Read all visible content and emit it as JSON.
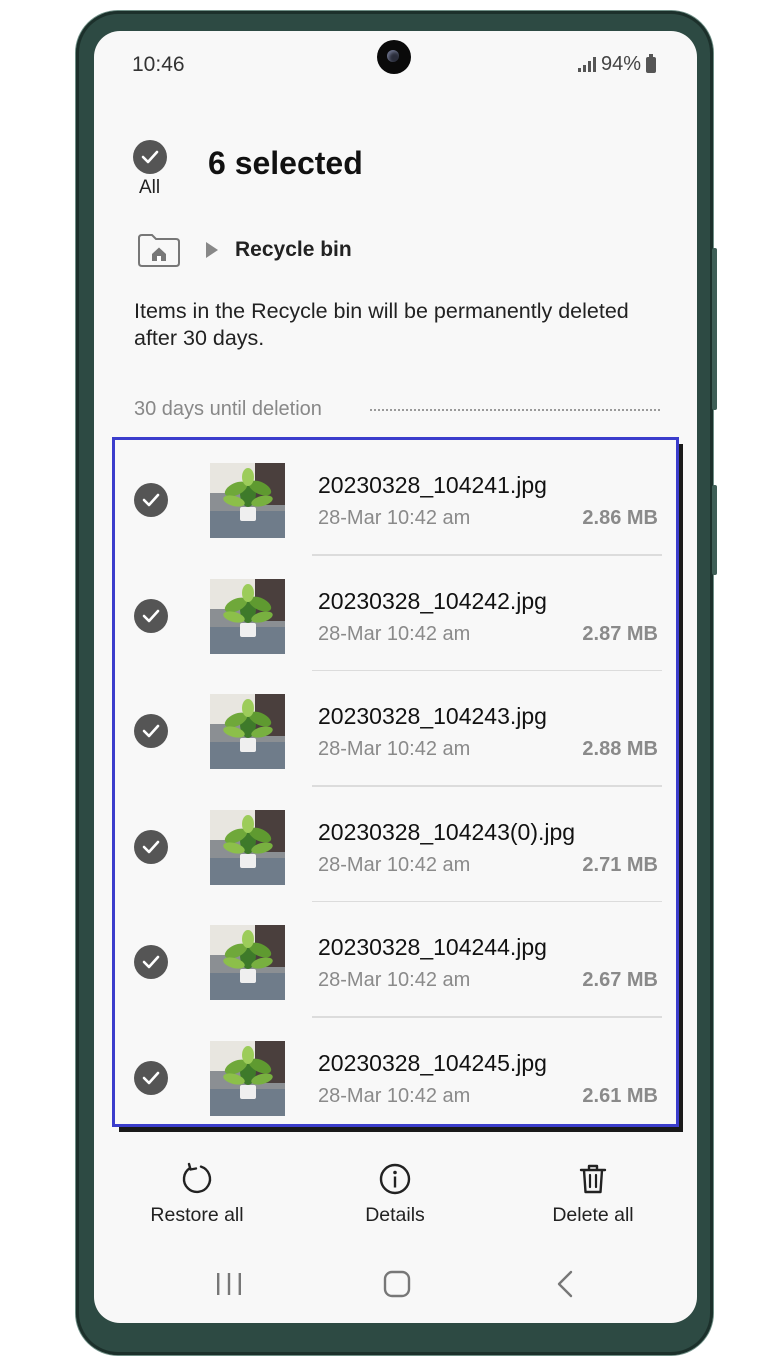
{
  "status_bar": {
    "time": "10:46",
    "battery": "94%"
  },
  "header": {
    "selected_label": "6 selected",
    "all_label": "All"
  },
  "breadcrumb": {
    "location": "Recycle bin"
  },
  "info_text": "Items in the Recycle bin will be permanently deleted after 30 days.",
  "section": {
    "label": "30 days until deletion"
  },
  "files": [
    {
      "name": "20230328_104241.jpg",
      "date": "28-Mar 10:42 am",
      "size": "2.86 MB",
      "checked": true
    },
    {
      "name": "20230328_104242.jpg",
      "date": "28-Mar 10:42 am",
      "size": "2.87 MB",
      "checked": true
    },
    {
      "name": "20230328_104243.jpg",
      "date": "28-Mar 10:42 am",
      "size": "2.88 MB",
      "checked": true
    },
    {
      "name": "20230328_104243(0).jpg",
      "date": "28-Mar 10:42 am",
      "size": "2.71 MB",
      "checked": true
    },
    {
      "name": "20230328_104244.jpg",
      "date": "28-Mar 10:42 am",
      "size": "2.67 MB",
      "checked": true
    },
    {
      "name": "20230328_104245.jpg",
      "date": "28-Mar 10:42 am",
      "size": "2.61 MB",
      "checked": true
    }
  ],
  "actions": {
    "restore_label": "Restore all",
    "details_label": "Details",
    "delete_label": "Delete all"
  },
  "icons": {
    "status": [
      "signal-icon",
      "battery-icon"
    ],
    "header": [
      "check-all-icon",
      "home-folder-icon",
      "breadcrumb-arrow-icon"
    ],
    "actions": [
      "restore-icon",
      "info-icon",
      "trash-icon"
    ],
    "nav": [
      "recents-icon",
      "home-icon",
      "back-icon"
    ]
  },
  "colors": {
    "highlight_border": "#3b3dcc",
    "check_fill": "#555555",
    "frame": "#2d4a43"
  }
}
